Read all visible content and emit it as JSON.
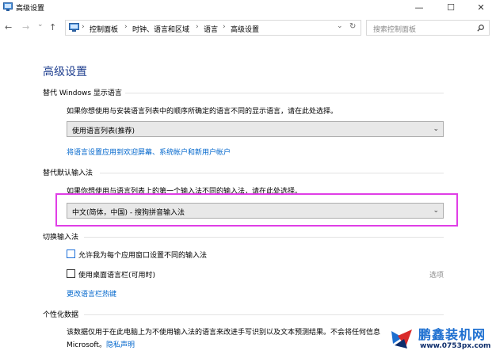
{
  "window": {
    "title": "高级设置",
    "minimize": "—",
    "maximize": "☐",
    "close": "✕"
  },
  "nav": {
    "back": "←",
    "forward": "→",
    "recent": "⌄",
    "up": "↑",
    "breadcrumb": [
      "控制面板",
      "时钟、语言和区域",
      "语言",
      "高级设置"
    ],
    "separator": "›",
    "dropdown": "⌄",
    "refresh": "↻",
    "search_placeholder": "搜索控制面板"
  },
  "page": {
    "title": "高级设置",
    "sections": {
      "display_language": {
        "title": "替代 Windows 显示语言",
        "description": "如果你想使用与安装语言列表中的顺序所确定的语言不同的显示语言，请在此处选择。",
        "dropdown_value": "使用语言列表(推荐)",
        "link": "将语言设置应用到欢迎屏幕、系统帐户和新用户帐户"
      },
      "input_method": {
        "title": "替代默认输入法",
        "description": "如果你想使用与语言列表上的第一个输入法不同的输入法，请在此处选择。",
        "dropdown_value": "中文(简体，中国) - 搜狗拼音输入法"
      },
      "switch_input": {
        "title": "切换输入法",
        "checkbox1": "允许我为每个应用窗口设置不同的输入法",
        "checkbox2": "使用桌面语言栏(可用时)",
        "options": "选项",
        "link": "更改语言栏热键"
      },
      "personalization": {
        "title": "个性化数据",
        "description": "该数据仅用于在此电脑上为不使用输入法的语言来改进手写识别以及文本预测结果。不会将任何信息",
        "description2": "Microsoft。",
        "privacy_link": "隐私声明"
      }
    }
  },
  "watermark": {
    "name": "鹏鑫装机网",
    "url": "www.0753px.com"
  },
  "colors": {
    "title_blue": "#1e3e8f",
    "link_blue": "#0066cc",
    "highlight": "#e03ee6"
  }
}
